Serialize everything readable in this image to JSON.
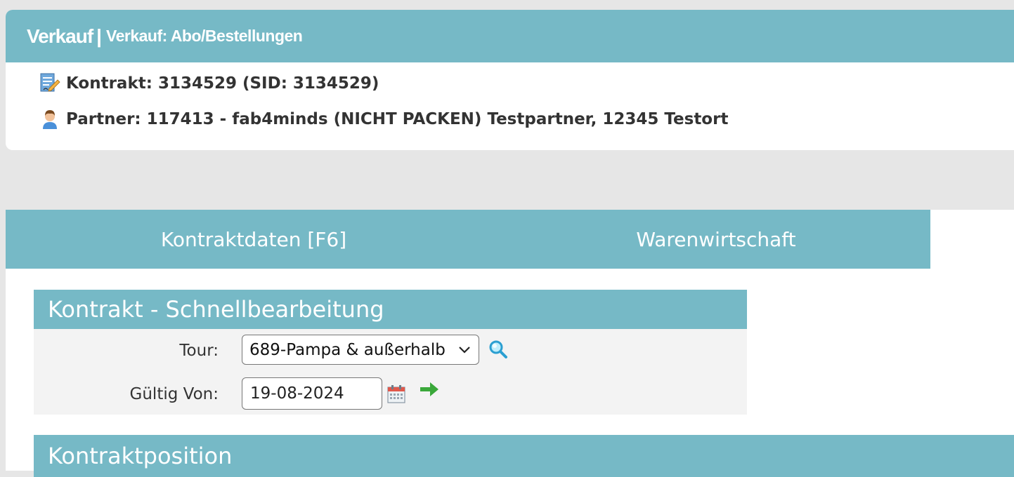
{
  "header": {
    "module": "Verkauf",
    "separator": "|",
    "subtitle": "Verkauf: Abo/Bestellungen"
  },
  "info": {
    "contract": "Kontrakt: 3134529 (SID: 3134529)",
    "partner": "Partner: 117413 - fab4minds (NICHT PACKEN) Testpartner, 12345 Testort"
  },
  "tabs": [
    {
      "label": "Kontraktdaten [F6]"
    },
    {
      "label": "Warenwirtschaft"
    }
  ],
  "quick_edit": {
    "title": "Kontrakt - Schnellbearbeitung",
    "tour_label": "Tour:",
    "tour_value": "689-Pampa & außerhalb",
    "valid_from_label": "Gültig Von:",
    "valid_from_value": "19-08-2024"
  },
  "position": {
    "title": "Kontraktposition"
  },
  "colors": {
    "accent": "#76b9c6",
    "background": "#e6e6e6"
  },
  "icons": [
    "contract-document-icon",
    "partner-person-icon",
    "search-icon",
    "calendar-icon",
    "arrow-right-icon",
    "chevron-down-icon"
  ]
}
